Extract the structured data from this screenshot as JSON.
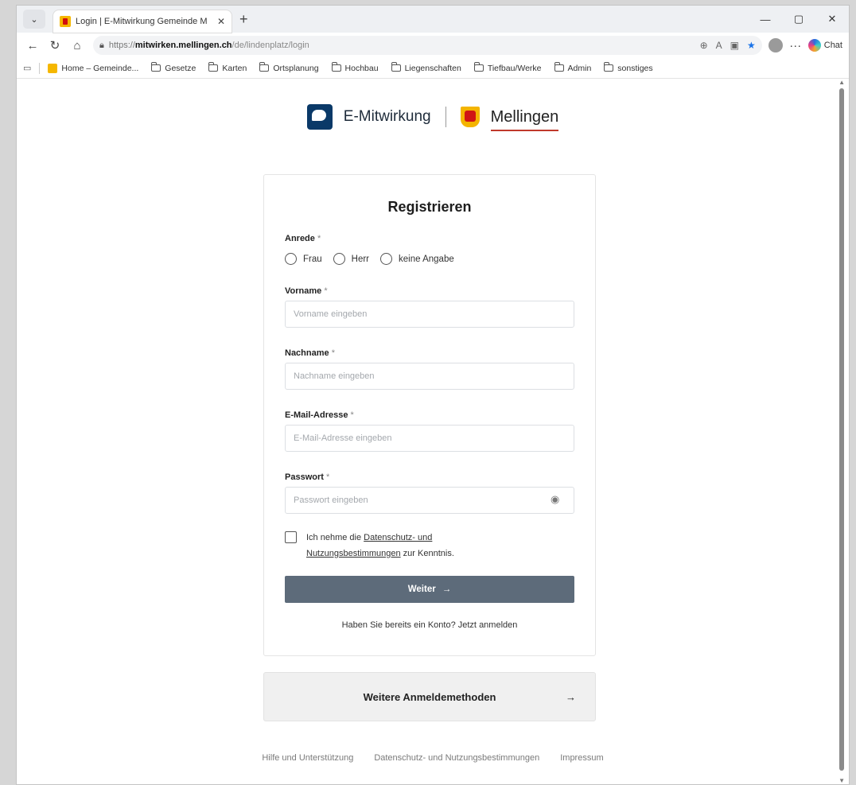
{
  "browser": {
    "tab_title": "Login | E-Mitwirkung Gemeinde M",
    "tab_close": "✕",
    "new_tab": "+",
    "url_prefix": "https://",
    "url_host": "mitwirken.mellingen.ch",
    "url_path": "/de/lindenplatz/login",
    "chat_label": "Chat",
    "bookmarks": [
      {
        "label": "Home – Gemeinde...",
        "kind": "favicon"
      },
      {
        "label": "Gesetze",
        "kind": "folder"
      },
      {
        "label": "Karten",
        "kind": "folder"
      },
      {
        "label": "Ortsplanung",
        "kind": "folder"
      },
      {
        "label": "Hochbau",
        "kind": "folder"
      },
      {
        "label": "Liegenschaften",
        "kind": "folder"
      },
      {
        "label": "Tiefbau/Werke",
        "kind": "folder"
      },
      {
        "label": "Admin",
        "kind": "folder"
      },
      {
        "label": "sonstiges",
        "kind": "folder"
      }
    ]
  },
  "brand": {
    "platform_name": "E-Mitwirkung",
    "municipality": "Mellingen"
  },
  "form": {
    "title": "Registrieren",
    "required_marker": "*",
    "salutation": {
      "label": "Anrede",
      "options": [
        "Frau",
        "Herr",
        "keine Angabe"
      ]
    },
    "firstname": {
      "label": "Vorname",
      "placeholder": "Vorname eingeben"
    },
    "lastname": {
      "label": "Nachname",
      "placeholder": "Nachname eingeben"
    },
    "email": {
      "label": "E-Mail-Adresse",
      "placeholder": "E-Mail-Adresse eingeben"
    },
    "password": {
      "label": "Passwort",
      "placeholder": "Passwort eingeben"
    },
    "consent": {
      "prefix": "Ich nehme die ",
      "link_line1": "Datenschutz- und",
      "link_line2": "Nutzungsbestimmungen",
      "suffix": " zur Kenntnis."
    },
    "submit_label": "Weiter",
    "submit_arrow": "→",
    "login_prompt": "Haben Sie bereits ein Konto? Jetzt",
    "login_link": "anmelden"
  },
  "more_methods": {
    "label": "Weitere Anmeldemethoden",
    "arrow": "→"
  },
  "footer": {
    "links": [
      "Hilfe und Unterstützung",
      "Datenschutz- und Nutzungsbestimmungen",
      "Impressum"
    ]
  }
}
